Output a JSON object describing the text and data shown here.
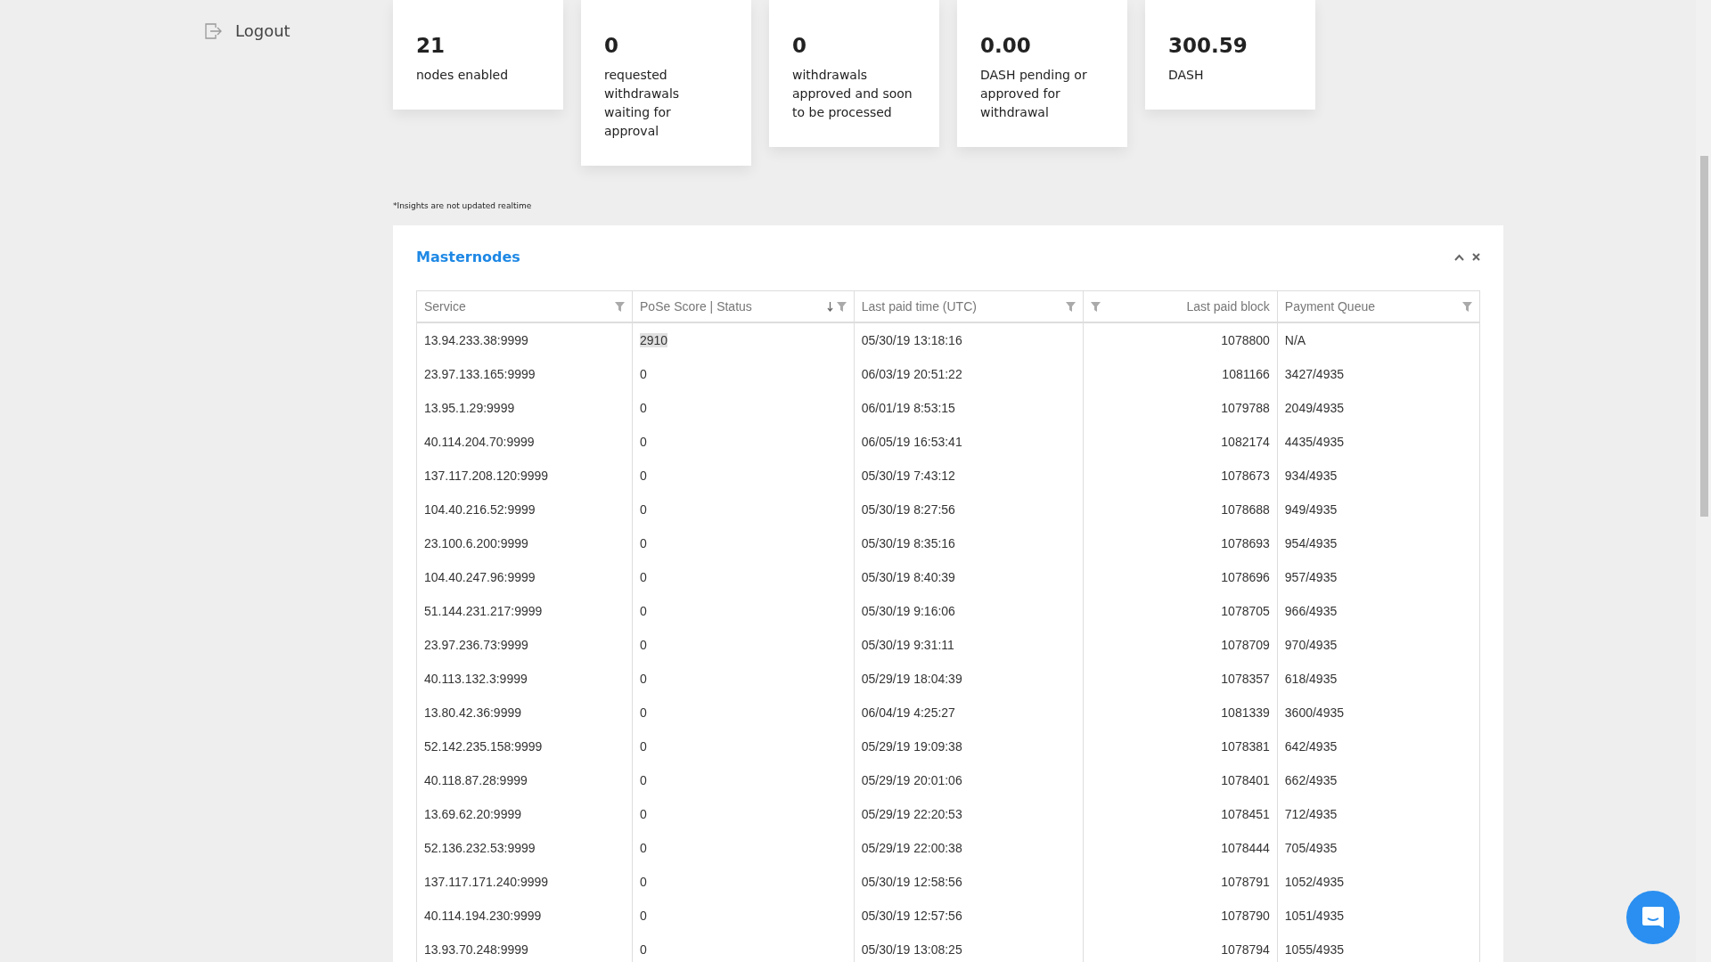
{
  "sidebar": {
    "logout": "Logout"
  },
  "stats": [
    {
      "value": "21",
      "label": "nodes enabled"
    },
    {
      "value": "0",
      "label": "requested withdrawals waiting for approval"
    },
    {
      "value": "0",
      "label": "withdrawals approved and soon to be processed"
    },
    {
      "value": "0.00",
      "label": "DASH pending or approved for withdrawal"
    },
    {
      "value": "300.59",
      "label": "DASH"
    }
  ],
  "note": "*Insights are not updated realtime",
  "panel": {
    "title": "Masternodes",
    "columns": [
      {
        "label": "Service",
        "right_aligned": false,
        "sorted_descending": false,
        "filter_left": false
      },
      {
        "label": "PoSe Score | Status",
        "right_aligned": false,
        "sorted_descending": true,
        "filter_left": false
      },
      {
        "label": "Last paid time (UTC)",
        "right_aligned": false,
        "sorted_descending": false,
        "filter_left": false
      },
      {
        "label": "Last paid block",
        "right_aligned": true,
        "sorted_descending": false,
        "filter_left": true
      },
      {
        "label": "Payment Queue",
        "right_aligned": false,
        "sorted_descending": false,
        "filter_left": false
      }
    ],
    "rows": [
      {
        "cells": [
          "13.94.233.38:9999",
          "2910",
          "05/30/19 13:18:16",
          "1078800",
          "N/A"
        ],
        "highlighted": true
      },
      {
        "cells": [
          "23.97.133.165:9999",
          "0",
          "06/03/19 20:51:22",
          "1081166",
          "3427/4935"
        ],
        "highlighted": false
      },
      {
        "cells": [
          "13.95.1.29:9999",
          "0",
          "06/01/19 8:53:15",
          "1079788",
          "2049/4935"
        ],
        "highlighted": false
      },
      {
        "cells": [
          "40.114.204.70:9999",
          "0",
          "06/05/19 16:53:41",
          "1082174",
          "4435/4935"
        ],
        "highlighted": false
      },
      {
        "cells": [
          "137.117.208.120:9999",
          "0",
          "05/30/19 7:43:12",
          "1078673",
          "934/4935"
        ],
        "highlighted": false
      },
      {
        "cells": [
          "104.40.216.52:9999",
          "0",
          "05/30/19 8:27:56",
          "1078688",
          "949/4935"
        ],
        "highlighted": false
      },
      {
        "cells": [
          "23.100.6.200:9999",
          "0",
          "05/30/19 8:35:16",
          "1078693",
          "954/4935"
        ],
        "highlighted": false
      },
      {
        "cells": [
          "104.40.247.96:9999",
          "0",
          "05/30/19 8:40:39",
          "1078696",
          "957/4935"
        ],
        "highlighted": false
      },
      {
        "cells": [
          "51.144.231.217:9999",
          "0",
          "05/30/19 9:16:06",
          "1078705",
          "966/4935"
        ],
        "highlighted": false
      },
      {
        "cells": [
          "23.97.236.73:9999",
          "0",
          "05/30/19 9:31:11",
          "1078709",
          "970/4935"
        ],
        "highlighted": false
      },
      {
        "cells": [
          "40.113.132.3:9999",
          "0",
          "05/29/19 18:04:39",
          "1078357",
          "618/4935"
        ],
        "highlighted": false
      },
      {
        "cells": [
          "13.80.42.36:9999",
          "0",
          "06/04/19 4:25:27",
          "1081339",
          "3600/4935"
        ],
        "highlighted": false
      },
      {
        "cells": [
          "52.142.235.158:9999",
          "0",
          "05/29/19 19:09:38",
          "1078381",
          "642/4935"
        ],
        "highlighted": false
      },
      {
        "cells": [
          "40.118.87.28:9999",
          "0",
          "05/29/19 20:01:06",
          "1078401",
          "662/4935"
        ],
        "highlighted": false
      },
      {
        "cells": [
          "13.69.62.20:9999",
          "0",
          "05/29/19 22:20:53",
          "1078451",
          "712/4935"
        ],
        "highlighted": false
      },
      {
        "cells": [
          "52.136.232.53:9999",
          "0",
          "05/29/19 22:00:38",
          "1078444",
          "705/4935"
        ],
        "highlighted": false
      },
      {
        "cells": [
          "137.117.171.240:9999",
          "0",
          "05/30/19 12:58:56",
          "1078791",
          "1052/4935"
        ],
        "highlighted": false
      },
      {
        "cells": [
          "40.114.194.230:9999",
          "0",
          "05/30/19 12:57:56",
          "1078790",
          "1051/4935"
        ],
        "highlighted": false
      },
      {
        "cells": [
          "13.93.70.248:9999",
          "0",
          "05/30/19 13:08:25",
          "1078794",
          "1055/4935"
        ],
        "highlighted": false
      }
    ]
  }
}
